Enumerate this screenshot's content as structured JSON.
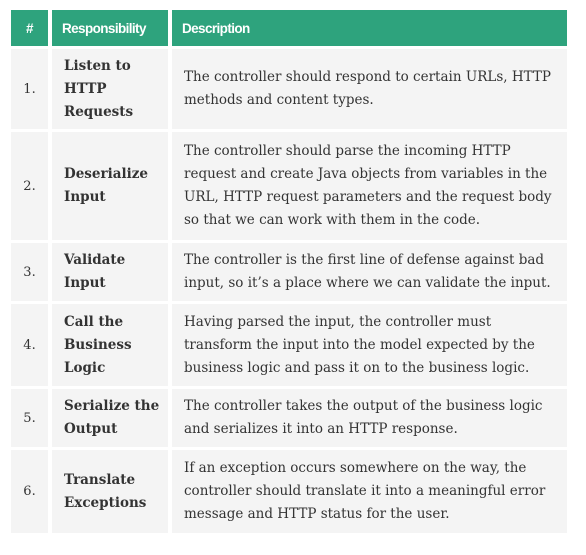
{
  "table": {
    "headers": {
      "number": "#",
      "responsibility": "Responsibility",
      "description": "Description"
    },
    "rows": [
      {
        "number": "1.",
        "responsibility": "Listen to HTTP Requests",
        "description": "The controller should respond to certain URLs, HTTP methods and content types."
      },
      {
        "number": "2.",
        "responsibility": "Deserialize Input",
        "description": "The controller should parse the incoming HTTP request and create Java objects from variables in the URL, HTTP request parameters and the request body so that we can work with them in the code."
      },
      {
        "number": "3.",
        "responsibility": "Validate Input",
        "description": "The controller is the first line of defense against bad input, so it’s a place where we can validate the input."
      },
      {
        "number": "4.",
        "responsibility": "Call the Business Logic",
        "description": "Having parsed the input, the controller must transform the input into the model expected by the business logic and pass it on to the business logic."
      },
      {
        "number": "5.",
        "responsibility": "Serialize the Output",
        "description": "The controller takes the output of the business logic and serializes it into an HTTP response."
      },
      {
        "number": "6.",
        "responsibility": "Translate Exceptions",
        "description": "If an exception occurs somewhere on the way, the controller should translate it into a meaningful error message and HTTP status for the user."
      }
    ]
  },
  "colors": {
    "header_background": "#2ea37d",
    "header_text": "#ffffff",
    "cell_background": "#f4f4f4",
    "body_text": "#333333"
  }
}
